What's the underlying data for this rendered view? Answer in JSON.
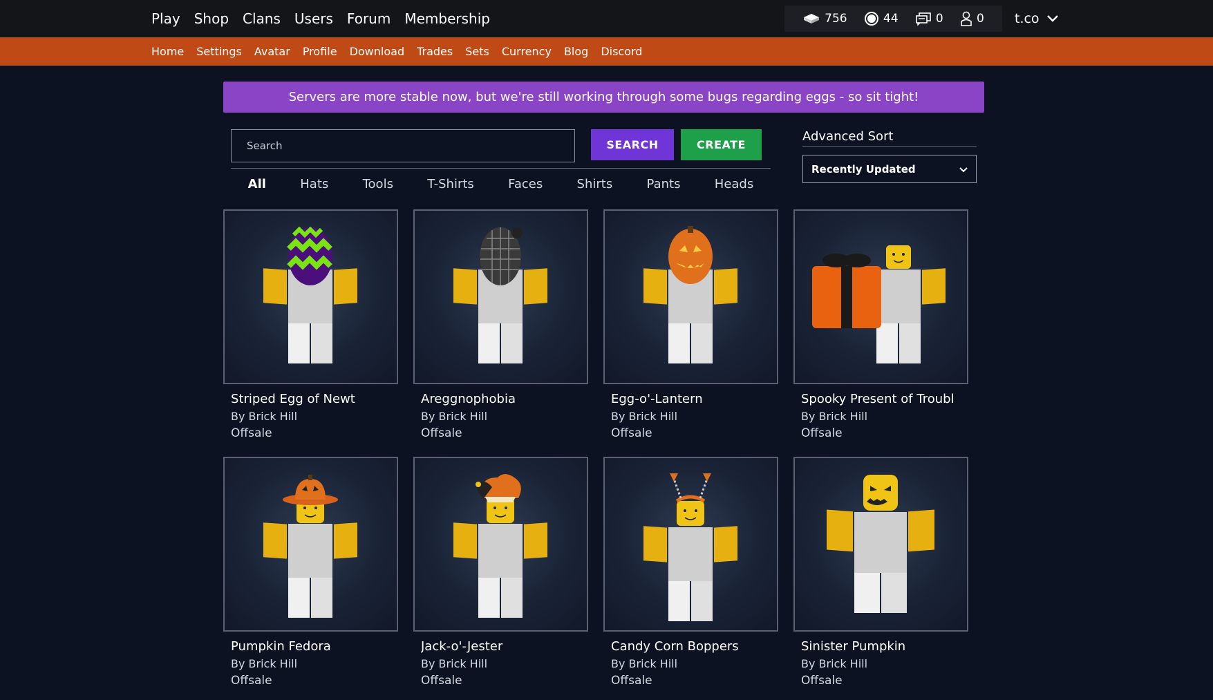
{
  "topnav": {
    "links": [
      "Play",
      "Shop",
      "Clans",
      "Users",
      "Forum",
      "Membership"
    ],
    "stats": {
      "bricks": "756",
      "bits": "44",
      "messages": "0",
      "friends": "0"
    },
    "username": "t.co"
  },
  "subnav": {
    "links": [
      "Home",
      "Settings",
      "Avatar",
      "Profile",
      "Download",
      "Trades",
      "Sets",
      "Currency",
      "Blog",
      "Discord"
    ]
  },
  "banner": {
    "text": "Servers are more stable now, but we're still working through some bugs regarding eggs - so sit tight!"
  },
  "search": {
    "placeholder": "Search",
    "search_label": "SEARCH",
    "create_label": "CREATE"
  },
  "categories": [
    "All",
    "Hats",
    "Tools",
    "T-Shirts",
    "Faces",
    "Shirts",
    "Pants",
    "Heads"
  ],
  "active_category": "All",
  "advanced_sort": {
    "title": "Advanced Sort",
    "selected": "Recently Updated"
  },
  "items": [
    {
      "name": "Striped Egg of Newt",
      "creator": "By Brick Hill",
      "price": "Offsale",
      "icon": "striped-egg"
    },
    {
      "name": "Areggnophobia",
      "creator": "By Brick Hill",
      "price": "Offsale",
      "icon": "cage-egg"
    },
    {
      "name": "Egg-o'-Lantern",
      "creator": "By Brick Hill",
      "price": "Offsale",
      "icon": "pumpkin-egg"
    },
    {
      "name": "Spooky Present of Troubl",
      "creator": "By Brick Hill",
      "price": "Offsale",
      "icon": "present"
    },
    {
      "name": "Pumpkin Fedora",
      "creator": "By Brick Hill",
      "price": "Offsale",
      "icon": "pumpkin-fedora"
    },
    {
      "name": "Jack-o'-Jester",
      "creator": "By Brick Hill",
      "price": "Offsale",
      "icon": "jester-hat"
    },
    {
      "name": "Candy Corn Boppers",
      "creator": "By Brick Hill",
      "price": "Offsale",
      "icon": "boppers"
    },
    {
      "name": "Sinister Pumpkin",
      "creator": "By Brick Hill",
      "price": "Offsale",
      "icon": "sinister-head"
    }
  ],
  "colors": {
    "topnav": "#141518",
    "subnav": "#c04a16",
    "banner": "#8a45c7",
    "search_button": "#6f35d6",
    "create_button": "#1ea04a",
    "background": "#0c1221"
  }
}
